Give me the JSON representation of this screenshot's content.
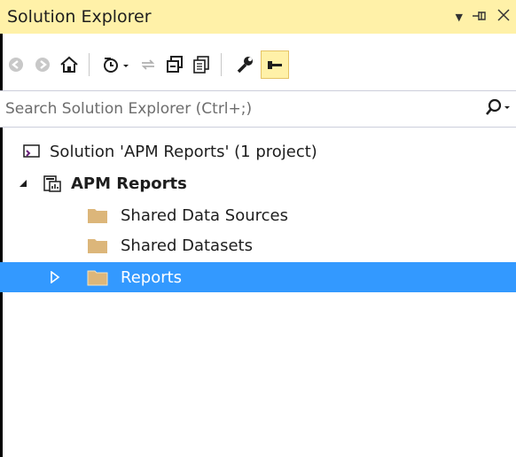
{
  "window": {
    "title": "Solution Explorer",
    "controls": {
      "dropdown": "▼",
      "pin": "⊣",
      "close": "X"
    }
  },
  "toolbar": {
    "buttons": [
      "back-icon",
      "forward-icon",
      "home-icon",
      "pending-changes-filter-icon",
      "sync-icon",
      "collapse-all-icon",
      "show-all-files-icon",
      "properties-icon",
      "preview-selected-items-icon"
    ]
  },
  "search": {
    "placeholder": "Search Solution Explorer (Ctrl+;)",
    "icon": "search-icon"
  },
  "tree": {
    "solution_label": "Solution 'APM Reports' (1 project)",
    "project_label": "APM Reports",
    "items": [
      {
        "label": "Shared Data Sources"
      },
      {
        "label": "Shared Datasets"
      },
      {
        "label": "Reports"
      }
    ],
    "selected": "Reports"
  },
  "colors": {
    "title_bg": "#fff1a8",
    "selection_bg": "#3399ff",
    "folder": "#dcb67a",
    "folder_dark": "#c9a063"
  }
}
